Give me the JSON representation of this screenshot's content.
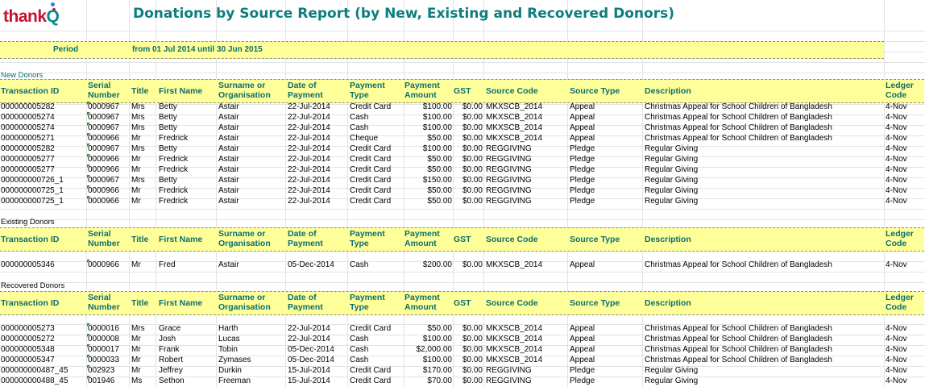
{
  "logo": {
    "text_main": "thank",
    "text_q": "Q"
  },
  "title": "Donations by Source Report (by New, Existing and Recovered Donors)",
  "period": {
    "label": "Period",
    "value": "from 01 Jul 2014 until 30 Jun 2015"
  },
  "headers": {
    "transaction_id": "Transaction ID",
    "serial_l1": "Serial",
    "serial_l2": "Number",
    "title": "Title",
    "first_name": "First Name",
    "surname_l1": "Surname or",
    "surname_l2": "Organisation",
    "date_l1": "Date of",
    "date_l2": "Payment",
    "ptype_l1": "Payment",
    "ptype_l2": "Type",
    "pamount_l1": "Payment",
    "pamount_l2": "Amount",
    "gst": "GST",
    "source_code": "Source Code",
    "source_type": "Source Type",
    "description": "Description",
    "ledger_l1": "Ledger",
    "ledger_l2": "Code"
  },
  "sections": {
    "new": {
      "label": "New Donors",
      "rows": [
        [
          "000000005282",
          "0000967",
          "Mrs",
          "Betty",
          "Astair",
          "22-Jul-2014",
          "Credit Card",
          "$100.00",
          "$0.00",
          "MKXSCB_2014",
          "Appeal",
          "Christmas Appeal for School Children of Bangladesh",
          "4-Nov"
        ],
        [
          "000000005274",
          "0000967",
          "Mrs",
          "Betty",
          "Astair",
          "22-Jul-2014",
          "Cash",
          "$100.00",
          "$0.00",
          "MKXSCB_2014",
          "Appeal",
          "Christmas Appeal for School Children of Bangladesh",
          "4-Nov"
        ],
        [
          "000000005274",
          "0000967",
          "Mrs",
          "Betty",
          "Astair",
          "22-Jul-2014",
          "Cash",
          "$100.00",
          "$0.00",
          "MKXSCB_2014",
          "Appeal",
          "Christmas Appeal for School Children of Bangladesh",
          "4-Nov"
        ],
        [
          "000000005271",
          "0000966",
          "Mr",
          "Fredrick",
          "Astair",
          "22-Jul-2014",
          "Cheque",
          "$50.00",
          "$0.00",
          "MKXSCB_2014",
          "Appeal",
          "Christmas Appeal for School Children of Bangladesh",
          "4-Nov"
        ],
        [
          "000000005282",
          "0000967",
          "Mrs",
          "Betty",
          "Astair",
          "22-Jul-2014",
          "Credit Card",
          "$100.00",
          "$0.00",
          "REGGIVING",
          "Pledge",
          "Regular Giving",
          "4-Nov"
        ],
        [
          "000000005277",
          "0000966",
          "Mr",
          "Fredrick",
          "Astair",
          "22-Jul-2014",
          "Credit Card",
          "$50.00",
          "$0.00",
          "REGGIVING",
          "Pledge",
          "Regular Giving",
          "4-Nov"
        ],
        [
          "000000005277",
          "0000966",
          "Mr",
          "Fredrick",
          "Astair",
          "22-Jul-2014",
          "Credit Card",
          "$50.00",
          "$0.00",
          "REGGIVING",
          "Pledge",
          "Regular Giving",
          "4-Nov"
        ],
        [
          "000000000726_1",
          "0000967",
          "Mrs",
          "Betty",
          "Astair",
          "22-Jul-2014",
          "Credit Card",
          "$150.00",
          "$0.00",
          "REGGIVING",
          "Pledge",
          "Regular Giving",
          "4-Nov"
        ],
        [
          "000000000725_1",
          "0000966",
          "Mr",
          "Fredrick",
          "Astair",
          "22-Jul-2014",
          "Credit Card",
          "$50.00",
          "$0.00",
          "REGGIVING",
          "Pledge",
          "Regular Giving",
          "4-Nov"
        ],
        [
          "000000000725_1",
          "0000966",
          "Mr",
          "Fredrick",
          "Astair",
          "22-Jul-2014",
          "Credit Card",
          "$50.00",
          "$0.00",
          "REGGIVING",
          "Pledge",
          "Regular Giving",
          "4-Nov"
        ]
      ]
    },
    "existing": {
      "label": "Existing Donors",
      "rows": [
        [
          "000000005346",
          "0000966",
          "Mr",
          "Fred",
          "Astair",
          "05-Dec-2014",
          "Cash",
          "$200.00",
          "$0.00",
          "MKXSCB_2014",
          "Appeal",
          "Christmas Appeal for School Children of Bangladesh",
          "4-Nov"
        ]
      ]
    },
    "recovered": {
      "label": "Recovered Donors",
      "rows": [
        [
          "000000005273",
          "0000016",
          "Mrs",
          "Grace",
          "Harth",
          "22-Jul-2014",
          "Credit Card",
          "$50.00",
          "$0.00",
          "MKXSCB_2014",
          "Appeal",
          "Christmas Appeal for School Children of Bangladesh",
          "4-Nov"
        ],
        [
          "000000005272",
          "0000008",
          "Mr",
          "Josh",
          "Lucas",
          "22-Jul-2014",
          "Cash",
          "$100.00",
          "$0.00",
          "MKXSCB_2014",
          "Appeal",
          "Christmas Appeal for School Children of Bangladesh",
          "4-Nov"
        ],
        [
          "000000005348",
          "0000017",
          "Mr",
          "Frank",
          "Tobin",
          "05-Dec-2014",
          "Cash",
          "$2,000.00",
          "$0.00",
          "MKXSCB_2014",
          "Appeal",
          "Christmas Appeal for School Children of Bangladesh",
          "4-Nov"
        ],
        [
          "000000005347",
          "0000033",
          "Mr",
          "Robert",
          "Zymases",
          "05-Dec-2014",
          "Cash",
          "$100.00",
          "$0.00",
          "MKXSCB_2014",
          "Appeal",
          "Christmas Appeal for School Children of Bangladesh",
          "4-Nov"
        ],
        [
          "000000000487_45",
          "002923",
          "Mr",
          "Jeffrey",
          "Durkin",
          "15-Jul-2014",
          "Credit Card",
          "$170.00",
          "$0.00",
          "REGGIVING",
          "Pledge",
          "Regular Giving",
          "4-Nov"
        ],
        [
          "000000000488_45",
          "001946",
          "Ms",
          "Sethon",
          "Freeman",
          "15-Jul-2014",
          "Credit Card",
          "$70.00",
          "$0.00",
          "REGGIVING",
          "Pledge",
          "Regular Giving",
          "4-Nov"
        ]
      ]
    }
  }
}
